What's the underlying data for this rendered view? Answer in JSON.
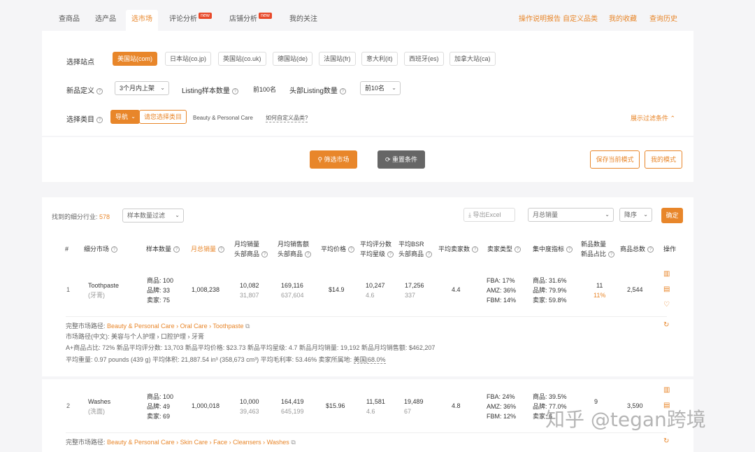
{
  "nav": {
    "tabs": [
      "查商品",
      "选产品",
      "选市场",
      "评论分析",
      "店铺分析",
      "我的关注"
    ],
    "new_badge": "new",
    "links": [
      "操作说明报告",
      "自定义品类",
      "我的收藏",
      "查询历史"
    ]
  },
  "filters": {
    "site_label": "选择站点",
    "sites": [
      "美国站(com)",
      "日本站(co.jp)",
      "英国站(co.uk)",
      "德国站(de)",
      "法国站(fr)",
      "意大利(it)",
      "西班牙(es)",
      "加拿大站(ca)"
    ],
    "new_def_label": "新品定义",
    "new_def_value": "3个月内上架",
    "sample_label": "Listing样本数量",
    "sample_value": "前100名",
    "head_label": "头部Listing数量",
    "head_value": "前10名",
    "category_label": "选择类目",
    "category_type": "导航",
    "category_pick": "请您选择类目",
    "category_value": "Beauty & Personal Care",
    "category_help": "如何自定义品类?",
    "toggle": "展示过滤条件",
    "btn_filter": "筛选市场",
    "btn_reset": "重置条件",
    "btn_save_mode": "保存当前模式",
    "btn_my_mode": "我的模式"
  },
  "results": {
    "found_label": "找到的细分行业:",
    "found_count": "578",
    "sample_filter": "样本数量过滤",
    "export": "导出Excel",
    "sort_field": "月总销量",
    "sort_order": "降序",
    "confirm": "确定"
  },
  "table": {
    "headers": {
      "idx": "#",
      "market": "细分市场",
      "sample": "样本数量",
      "monthly_sales": "月总销量",
      "avg_sales_1": "月均销量",
      "avg_sales_2": "头部商品",
      "avg_rev_1": "月均销售额",
      "avg_rev_2": "头部商品",
      "avg_price": "平均价格",
      "avg_reviews_1": "平均评分数",
      "avg_reviews_2": "平均星级",
      "avg_bsr_1": "平均BSR",
      "avg_bsr_2": "头部商品",
      "avg_sellers": "平均卖家数",
      "seller_type": "卖家类型",
      "concentration": "集中度指标",
      "new_count_1": "新品数量",
      "new_count_2": "新品占比",
      "total": "商品总数",
      "ops": "操作"
    },
    "rows": [
      {
        "idx": "1",
        "name": "Toothpaste",
        "name_cn": "(牙膏)",
        "sample": [
          "商品: 100",
          "品牌: 33",
          "卖家: 75"
        ],
        "monthly_sales": "1,008,238",
        "avg_sales": "10,082",
        "avg_sales_head": "31,807",
        "avg_rev": "169,116",
        "avg_rev_head": "637,604",
        "avg_price": "$14.9",
        "avg_reviews": "10,247",
        "avg_rating": "4.6",
        "avg_bsr": "17,256",
        "avg_bsr_head": "337",
        "avg_sellers": "4.4",
        "seller_type": [
          "FBA: 17%",
          "AMZ: 36%",
          "FBM: 14%"
        ],
        "concentration": [
          "商品: 31.6%",
          "品牌: 79.9%",
          "卖家: 59.8%"
        ],
        "new_count": "11",
        "new_ratio": "11%",
        "total": "2,544",
        "path_label": "完整市场路径:",
        "path": "Beauty & Personal Care › Oral Care › Toothpaste",
        "path_cn": "市场路径(中文): 美容与个人护理 › 口腔护理 › 牙膏",
        "stats1": "A+商品占比: 72%    新品平均评分数: 13,703    新品平均价格: $23.73    新品平均星级: 4.7    新品月均销量: 19,192    新品月均销售额: $462,207",
        "stats2": "平均重量: 0.97 pounds (439 g)    平均体积: 21,887.54 in³ (358,673 cm³)    平均毛利率: 53.46%    卖家所属地:",
        "seller_loc": "美国|68.0%"
      },
      {
        "idx": "2",
        "name": "Washes",
        "name_cn": "(洗面)",
        "sample": [
          "商品: 100",
          "品牌: 49",
          "卖家: 69"
        ],
        "monthly_sales": "1,000,018",
        "avg_sales": "10,000",
        "avg_sales_head": "39,463",
        "avg_rev": "164,419",
        "avg_rev_head": "645,199",
        "avg_price": "$15.96",
        "avg_reviews": "11,581",
        "avg_rating": "4.6",
        "avg_bsr": "19,489",
        "avg_bsr_head": "67",
        "avg_sellers": "4.8",
        "seller_type": [
          "FBA: 24%",
          "AMZ: 36%",
          "FBM: 12%"
        ],
        "concentration": [
          "商品: 39.5%",
          "品牌: 77.0%",
          "卖家: 6"
        ],
        "new_count": "9",
        "total": "3,590",
        "path_label": "完整市场路径:",
        "path": "Beauty & Personal Care › Skin Care › Face › Cleansers › Washes"
      }
    ]
  },
  "watermark": "知乎 @tegan跨境",
  "colors": {
    "accent": "#e8862a",
    "badge": "#e8492a"
  }
}
